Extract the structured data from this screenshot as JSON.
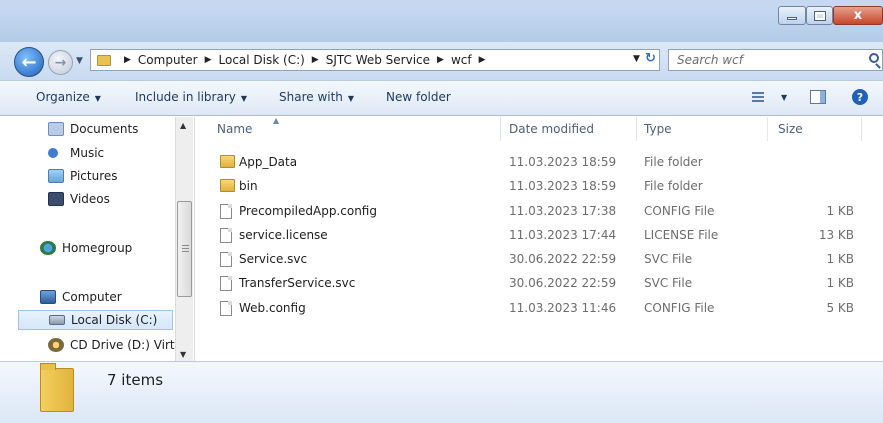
{
  "window": {
    "close_glyph": "x"
  },
  "address": {
    "crumbs": [
      "Computer",
      "Local Disk (C:)",
      "SJTC Web Service",
      "wcf"
    ]
  },
  "search": {
    "placeholder": "Search wcf"
  },
  "toolbar": {
    "organize": "Organize",
    "include_in_library": "Include in library",
    "share_with": "Share with",
    "new_folder": "New folder"
  },
  "nav": {
    "items": [
      {
        "label": "Documents",
        "icon": "documents-icon"
      },
      {
        "label": "Music",
        "icon": "music-icon"
      },
      {
        "label": "Pictures",
        "icon": "pictures-icon"
      },
      {
        "label": "Videos",
        "icon": "videos-icon"
      },
      {
        "label": "Homegroup",
        "icon": "homegroup-icon"
      },
      {
        "label": "Computer",
        "icon": "computer-icon"
      },
      {
        "label": "Local Disk (C:)",
        "icon": "disk-icon",
        "selected": true
      },
      {
        "label": "CD Drive (D:) Virtu",
        "icon": "cd-drive-icon"
      }
    ]
  },
  "columns": {
    "name": "Name",
    "date": "Date modified",
    "type": "Type",
    "size": "Size"
  },
  "files": [
    {
      "name": "App_Data",
      "date": "11.03.2023 18:59",
      "type": "File folder",
      "size": "",
      "kind": "folder"
    },
    {
      "name": "bin",
      "date": "11.03.2023 18:59",
      "type": "File folder",
      "size": "",
      "kind": "folder"
    },
    {
      "name": "PrecompiledApp.config",
      "date": "11.03.2023 17:38",
      "type": "CONFIG File",
      "size": "1 KB",
      "kind": "file"
    },
    {
      "name": "service.license",
      "date": "11.03.2023 17:44",
      "type": "LICENSE File",
      "size": "13 KB",
      "kind": "file"
    },
    {
      "name": "Service.svc",
      "date": "30.06.2022 22:59",
      "type": "SVC File",
      "size": "1 KB",
      "kind": "file"
    },
    {
      "name": "TransferService.svc",
      "date": "30.06.2022 22:59",
      "type": "SVC File",
      "size": "1 KB",
      "kind": "file"
    },
    {
      "name": "Web.config",
      "date": "11.03.2023 11:46",
      "type": "CONFIG File",
      "size": "5 KB",
      "kind": "file"
    }
  ],
  "details": {
    "item_count": "7 items"
  },
  "colors": {
    "accent": "#1f5fb8",
    "folder": "#e8c252",
    "selection": "#d3e6fa"
  }
}
